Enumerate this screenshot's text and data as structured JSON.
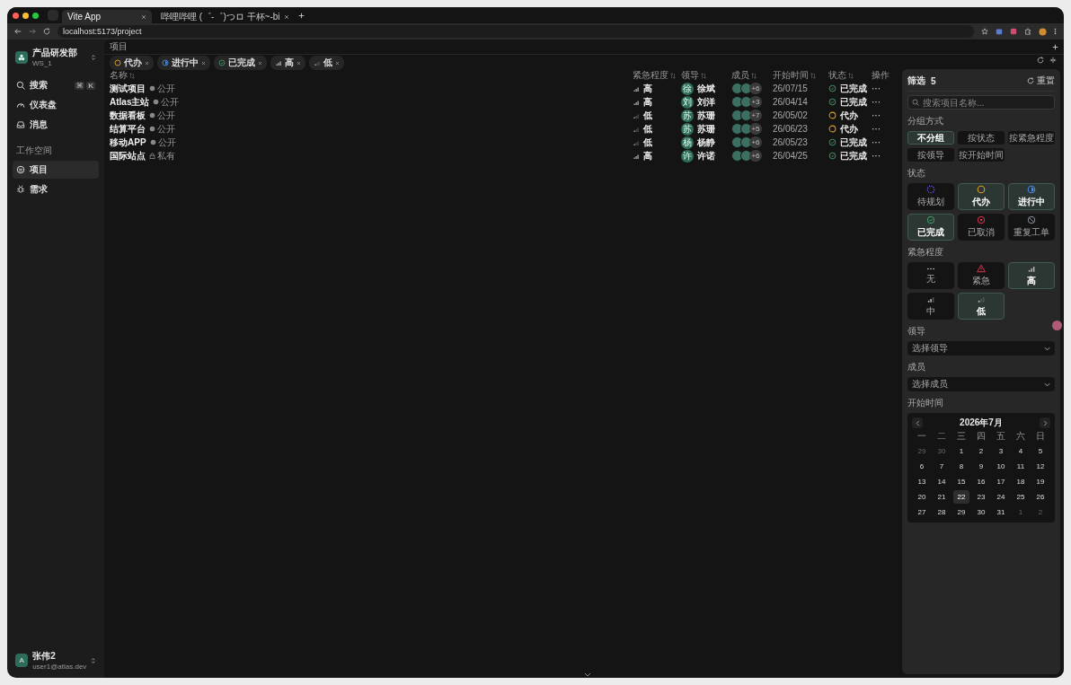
{
  "browser": {
    "tabs": [
      {
        "title": "Vite App",
        "selected": true
      },
      {
        "title": "哔哩哔哩 (゜-゜)つロ 干杯~-bi",
        "selected": false
      }
    ],
    "address": "localhost:5173/project"
  },
  "sidebar": {
    "workspace": {
      "name": "产品研发部",
      "id": "WS_1"
    },
    "items": [
      {
        "label": "搜索",
        "kind": "search",
        "selected": false,
        "keys": [
          "⌘",
          "K"
        ]
      },
      {
        "label": "仪表盘",
        "kind": "gauge",
        "selected": false
      },
      {
        "label": "消息",
        "kind": "inbox",
        "selected": false
      }
    ],
    "section": "工作空间",
    "workspace_items": [
      {
        "label": "项目",
        "kind": "project",
        "selected": true
      },
      {
        "label": "需求",
        "kind": "bug",
        "selected": false
      }
    ],
    "user": {
      "avatar": "A",
      "name": "张伟2",
      "email": "user1@atlas.dev"
    }
  },
  "page_title": "项目",
  "filter_chips": [
    {
      "label": "代办",
      "kind": "todo"
    },
    {
      "label": "进行中",
      "kind": "in_progress"
    },
    {
      "label": "已完成",
      "kind": "done"
    },
    {
      "label": "高",
      "kind": "high"
    },
    {
      "label": "低",
      "kind": "low"
    }
  ],
  "table": {
    "columns": [
      "名称",
      "紧急程度",
      "领导",
      "成员",
      "开始时间",
      "状态",
      "操作"
    ],
    "rows": [
      {
        "name": "测试项目",
        "visibility": "公开",
        "private": false,
        "urgency": {
          "label": "高",
          "kind": "high"
        },
        "leader_avatar": "徐",
        "leader": "徐斌",
        "members_more": "+6",
        "start": "26/07/15",
        "status": {
          "label": "已完成",
          "kind": "done"
        },
        "action": "···"
      },
      {
        "name": "Atlas主站",
        "visibility": "公开",
        "private": false,
        "urgency": {
          "label": "高",
          "kind": "high"
        },
        "leader_avatar": "刘",
        "leader": "刘洋",
        "members_more": "+3",
        "start": "26/04/14",
        "status": {
          "label": "已完成",
          "kind": "done"
        },
        "action": "···"
      },
      {
        "name": "数据看板",
        "visibility": "公开",
        "private": false,
        "urgency": {
          "label": "低",
          "kind": "low"
        },
        "leader_avatar": "苏",
        "leader": "苏珊",
        "members_more": "+7",
        "start": "26/05/02",
        "status": {
          "label": "代办",
          "kind": "todo"
        },
        "action": "···"
      },
      {
        "name": "结算平台",
        "visibility": "公开",
        "private": false,
        "urgency": {
          "label": "低",
          "kind": "low"
        },
        "leader_avatar": "苏",
        "leader": "苏珊",
        "members_more": "+5",
        "start": "26/06/23",
        "status": {
          "label": "代办",
          "kind": "todo"
        },
        "action": "···"
      },
      {
        "name": "移动APP",
        "visibility": "公开",
        "private": false,
        "urgency": {
          "label": "低",
          "kind": "low"
        },
        "leader_avatar": "杨",
        "leader": "杨静",
        "members_more": "+6",
        "start": "26/05/23",
        "status": {
          "label": "已完成",
          "kind": "done"
        },
        "action": "···"
      },
      {
        "name": "国际站点",
        "visibility": "私有",
        "private": true,
        "urgency": {
          "label": "高",
          "kind": "high"
        },
        "leader_avatar": "许",
        "leader": "许诺",
        "members_more": "+6",
        "start": "26/04/25",
        "status": {
          "label": "已完成",
          "kind": "done"
        },
        "action": "···"
      }
    ]
  },
  "filter_panel": {
    "title": "筛选",
    "count": "5",
    "reset": "重置",
    "search_placeholder": "搜索项目名称...",
    "group_label": "分组方式",
    "group_options": [
      {
        "label": "不分组",
        "selected": true
      },
      {
        "label": "按状态",
        "selected": false
      },
      {
        "label": "按紧急程度",
        "selected": false
      },
      {
        "label": "按领导",
        "selected": false
      },
      {
        "label": "按开始时间",
        "selected": false
      }
    ],
    "status_label": "状态",
    "status_options": [
      {
        "label": "待规划",
        "kind": "planned",
        "selected": false
      },
      {
        "label": "代办",
        "kind": "todo",
        "selected": true
      },
      {
        "label": "进行中",
        "kind": "in_progress",
        "selected": true
      },
      {
        "label": "已完成",
        "kind": "done",
        "selected": true
      },
      {
        "label": "已取消",
        "kind": "cancelled",
        "selected": false
      },
      {
        "label": "重复工单",
        "kind": "duplicate",
        "selected": false
      }
    ],
    "urgency_label": "紧急程度",
    "urgency_options": [
      {
        "label": "无",
        "kind": "none",
        "selected": false
      },
      {
        "label": "紧急",
        "kind": "urgent",
        "selected": false
      },
      {
        "label": "高",
        "kind": "high",
        "selected": true
      },
      {
        "label": "中",
        "kind": "medium",
        "selected": false
      },
      {
        "label": "低",
        "kind": "low",
        "selected": true
      }
    ],
    "leader_label": "领导",
    "leader_placeholder": "选择领导",
    "member_label": "成员",
    "member_placeholder": "选择成员",
    "date_label": "开始时间",
    "calendar": {
      "month": "2026年7月",
      "weekdays": [
        "一",
        "二",
        "三",
        "四",
        "五",
        "六",
        "日"
      ],
      "days": [
        {
          "d": "29",
          "outside": true,
          "selected": false
        },
        {
          "d": "30",
          "outside": true,
          "selected": false
        },
        {
          "d": "1",
          "outside": false,
          "selected": false
        },
        {
          "d": "2",
          "outside": false,
          "selected": false
        },
        {
          "d": "3",
          "outside": false,
          "selected": false
        },
        {
          "d": "4",
          "outside": false,
          "selected": false
        },
        {
          "d": "5",
          "outside": false,
          "selected": false
        },
        {
          "d": "6",
          "outside": false,
          "selected": false
        },
        {
          "d": "7",
          "outside": false,
          "selected": false
        },
        {
          "d": "8",
          "outside": false,
          "selected": false
        },
        {
          "d": "9",
          "outside": false,
          "selected": false
        },
        {
          "d": "10",
          "outside": false,
          "selected": false
        },
        {
          "d": "11",
          "outside": false,
          "selected": false
        },
        {
          "d": "12",
          "outside": false,
          "selected": false
        },
        {
          "d": "13",
          "outside": false,
          "selected": false
        },
        {
          "d": "14",
          "outside": false,
          "selected": false
        },
        {
          "d": "15",
          "outside": false,
          "selected": false
        },
        {
          "d": "16",
          "outside": false,
          "selected": false
        },
        {
          "d": "17",
          "outside": false,
          "selected": false
        },
        {
          "d": "18",
          "outside": false,
          "selected": false
        },
        {
          "d": "19",
          "outside": false,
          "selected": false
        },
        {
          "d": "20",
          "outside": false,
          "selected": false
        },
        {
          "d": "21",
          "outside": false,
          "selected": false
        },
        {
          "d": "22",
          "outside": false,
          "selected": true
        },
        {
          "d": "23",
          "outside": false,
          "selected": false
        },
        {
          "d": "24",
          "outside": false,
          "selected": false
        },
        {
          "d": "25",
          "outside": false,
          "selected": false
        },
        {
          "d": "26",
          "outside": false,
          "selected": false
        },
        {
          "d": "27",
          "outside": false,
          "selected": false
        },
        {
          "d": "28",
          "outside": false,
          "selected": false
        },
        {
          "d": "29",
          "outside": false,
          "selected": false
        },
        {
          "d": "30",
          "outside": false,
          "selected": false
        },
        {
          "d": "31",
          "outside": false,
          "selected": false
        },
        {
          "d": "1",
          "outside": true,
          "selected": false
        },
        {
          "d": "2",
          "outside": true,
          "selected": false
        }
      ]
    }
  }
}
